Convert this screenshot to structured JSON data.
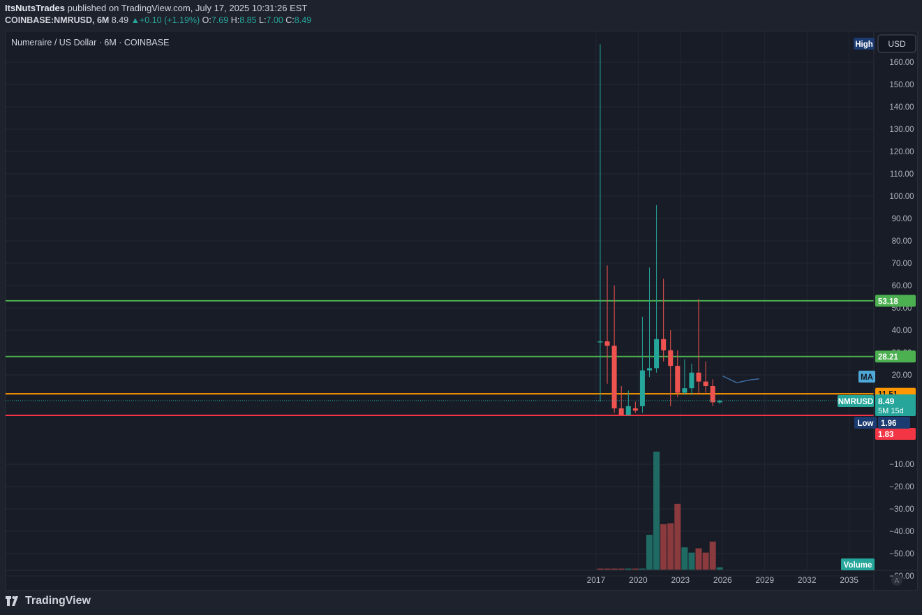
{
  "header": {
    "author": "ItsNutsTrades",
    "published_text": "published on TradingView.com, July 17, 2025 10:31:26 EST",
    "symbol": "COINBASE:NMRUSD, 6M",
    "last": "8.49",
    "change_arrow": "▲",
    "change": "+0.10 (+1.19%)",
    "o_label": "O:",
    "o": "7.69",
    "h_label": "H:",
    "h": "8.85",
    "l_label": "L:",
    "l": "7.00",
    "c_label": "C:",
    "c": "8.49"
  },
  "legend": {
    "title": "Numeraire / US Dollar · 6M · COINBASE"
  },
  "currency_button": "USD",
  "auto_button": "A",
  "footer": {
    "brand": "TradingView"
  },
  "colors": {
    "up": "#26a69a",
    "down": "#ef5350",
    "up_volume": "#1f6b64",
    "down_volume": "#8b3a3e",
    "support_green": "#4caf50",
    "ma_orange": "#ff9800",
    "low_red": "#f23645",
    "ma_line": "#2962ff",
    "background": "#181c27",
    "grid": "#232733"
  },
  "chart_data": {
    "type": "candlestick",
    "title": "Numeraire / US Dollar · 6M · COINBASE",
    "x_ticks": [
      "2017",
      "2020",
      "2023",
      "2026",
      "2029",
      "2032",
      "2035"
    ],
    "y_ticks": [
      "160.00",
      "150.00",
      "140.00",
      "130.00",
      "120.00",
      "110.00",
      "100.00",
      "90.00",
      "80.00",
      "70.00",
      "60.00",
      "50.00",
      "40.00",
      "30.00",
      "20.00"
    ],
    "volume_ticks": [
      "−10.00",
      "−20.00",
      "−30.00",
      "−40.00",
      "−50.00",
      "−60.00"
    ],
    "candles": [
      {
        "t": 2017.3,
        "o": 35,
        "h": 168,
        "l": 8,
        "c": 35
      },
      {
        "t": 2017.8,
        "o": 35,
        "h": 69,
        "l": 16,
        "c": 33
      },
      {
        "t": 2018.3,
        "o": 33,
        "h": 60,
        "l": 3,
        "c": 5
      },
      {
        "t": 2018.8,
        "o": 5,
        "h": 15,
        "l": 2.5,
        "c": 1.96
      },
      {
        "t": 2019.3,
        "o": 1.96,
        "h": 13,
        "l": 1.96,
        "c": 6
      },
      {
        "t": 2019.8,
        "o": 5,
        "h": 8,
        "l": 3,
        "c": 4
      },
      {
        "t": 2020.3,
        "o": 6,
        "h": 46,
        "l": 3,
        "c": 22
      },
      {
        "t": 2020.8,
        "o": 22,
        "h": 68,
        "l": 19,
        "c": 23
      },
      {
        "t": 2021.3,
        "o": 23,
        "h": 96,
        "l": 21,
        "c": 36
      },
      {
        "t": 2021.8,
        "o": 36,
        "h": 63,
        "l": 26,
        "c": 31
      },
      {
        "t": 2022.3,
        "o": 31,
        "h": 40,
        "l": 6,
        "c": 24
      },
      {
        "t": 2022.8,
        "o": 24,
        "h": 31,
        "l": 10,
        "c": 12
      },
      {
        "t": 2023.3,
        "o": 12,
        "h": 27,
        "l": 11,
        "c": 14
      },
      {
        "t": 2023.8,
        "o": 14,
        "h": 25,
        "l": 11,
        "c": 21
      },
      {
        "t": 2024.3,
        "o": 21,
        "h": 54,
        "l": 11,
        "c": 17
      },
      {
        "t": 2024.8,
        "o": 17,
        "h": 26,
        "l": 12,
        "c": 15
      },
      {
        "t": 2025.3,
        "o": 15,
        "h": 18,
        "l": 6,
        "c": 7.7
      },
      {
        "t": 2025.8,
        "o": 7.69,
        "h": 8.85,
        "l": 7.0,
        "c": 8.49
      }
    ],
    "volume": [
      {
        "t": 2017.3,
        "v": 0.3,
        "up": false
      },
      {
        "t": 2017.8,
        "v": 0.3,
        "up": false
      },
      {
        "t": 2018.3,
        "v": 0.3,
        "up": false
      },
      {
        "t": 2018.8,
        "v": 0.3,
        "up": false
      },
      {
        "t": 2019.3,
        "v": 0.3,
        "up": true
      },
      {
        "t": 2019.8,
        "v": 0.3,
        "up": false
      },
      {
        "t": 2020.3,
        "v": 0.5,
        "up": true
      },
      {
        "t": 2020.8,
        "v": 18,
        "up": true
      },
      {
        "t": 2021.3,
        "v": 61,
        "up": true
      },
      {
        "t": 2021.8,
        "v": 23.5,
        "up": false
      },
      {
        "t": 2022.3,
        "v": 24,
        "up": false
      },
      {
        "t": 2022.8,
        "v": 34,
        "up": false
      },
      {
        "t": 2023.3,
        "v": 11.5,
        "up": true
      },
      {
        "t": 2023.8,
        "v": 8.8,
        "up": true
      },
      {
        "t": 2024.3,
        "v": 11,
        "up": false
      },
      {
        "t": 2024.8,
        "v": 8.8,
        "up": false
      },
      {
        "t": 2025.3,
        "v": 14.5,
        "up": false
      },
      {
        "t": 2025.8,
        "v": 1.2,
        "up": true
      }
    ],
    "ma_line": [
      {
        "t": 2026.0,
        "y": 19.5
      },
      {
        "t": 2027.0,
        "y": 16.5
      },
      {
        "t": 2028.0,
        "y": 17.8
      },
      {
        "t": 2028.6,
        "y": 18.2
      }
    ],
    "horizontal_lines": [
      {
        "value": 53.18,
        "label": "53.18",
        "color": "#4caf50"
      },
      {
        "value": 28.21,
        "label": "28.21",
        "color": "#4caf50"
      },
      {
        "value": 11.51,
        "label": "11.51",
        "color": "#ff9800"
      },
      {
        "value": 1.83,
        "label": "1.83",
        "color": "#f23645"
      }
    ],
    "price_tags": {
      "high": "High",
      "low_text": "Low",
      "low_value": "1.96",
      "ma_tag": "MA",
      "symbol_tag": "NMRUSD",
      "last_price": "8.49",
      "countdown": "5M 15d",
      "volume_tag": "Volume"
    }
  }
}
